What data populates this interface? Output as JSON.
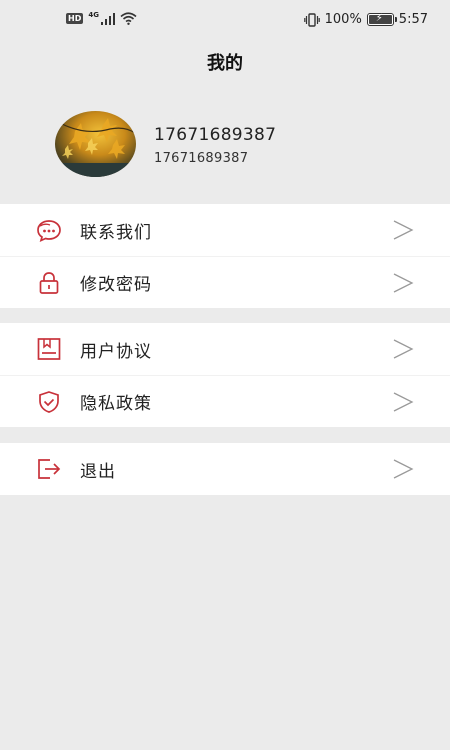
{
  "status_bar": {
    "left_badge": "HD",
    "network": "4G",
    "battery_percent": "100%",
    "time": "5:57"
  },
  "header": {
    "title": "我的"
  },
  "profile": {
    "name": "17671689387",
    "phone": "17671689387"
  },
  "menu": {
    "group1": [
      {
        "label": "联系我们",
        "icon": "chat-icon"
      },
      {
        "label": "修改密码",
        "icon": "lock-icon"
      }
    ],
    "group2": [
      {
        "label": "用户协议",
        "icon": "agreement-icon"
      },
      {
        "label": "隐私政策",
        "icon": "shield-icon"
      }
    ],
    "group3": [
      {
        "label": "退出",
        "icon": "logout-icon"
      }
    ]
  },
  "colors": {
    "accent": "#c8323a",
    "background": "#ebebeb",
    "card": "#ffffff",
    "chevron": "#9a9a9a"
  }
}
